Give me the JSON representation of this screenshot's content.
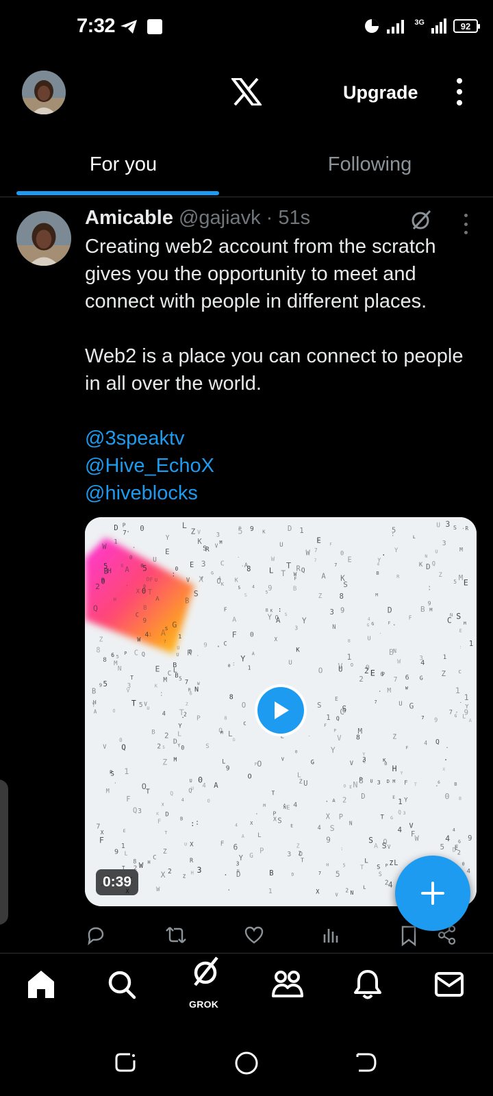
{
  "status_bar": {
    "time": "7:32",
    "battery": "92",
    "network": "3G"
  },
  "header": {
    "logo": "x-logo-icon",
    "upgrade_label": "Upgrade"
  },
  "tabs": [
    {
      "label": "For you",
      "active": true
    },
    {
      "label": "Following",
      "active": false
    }
  ],
  "tweet": {
    "author_name": "Amicable",
    "author_handle": "@gajiavk",
    "separator": "·",
    "time": "51s",
    "text_paragraphs": [
      "Creating web2 account from the scratch gives you the opportunity to meet and connect with people in different places.",
      "Web2 is a place you can connect to people in all over the world."
    ],
    "mentions": [
      "@3speaktv",
      "@Hive_EchoX",
      "@hiveblocks"
    ],
    "media": {
      "type": "video",
      "duration": "0:39"
    },
    "actions": [
      "reply-icon",
      "retweet-icon",
      "like-icon",
      "views-icon",
      "bookmark-icon",
      "share-icon"
    ]
  },
  "bottom_nav": {
    "items": [
      "home-icon",
      "search-icon",
      "grok-icon",
      "communities-icon",
      "notifications-icon",
      "messages-icon"
    ],
    "grok_label": "GROK"
  },
  "colors": {
    "accent": "#1d9bf0",
    "background": "#000000",
    "secondary_text": "#71767b",
    "primary_text": "#e7e9ea"
  }
}
